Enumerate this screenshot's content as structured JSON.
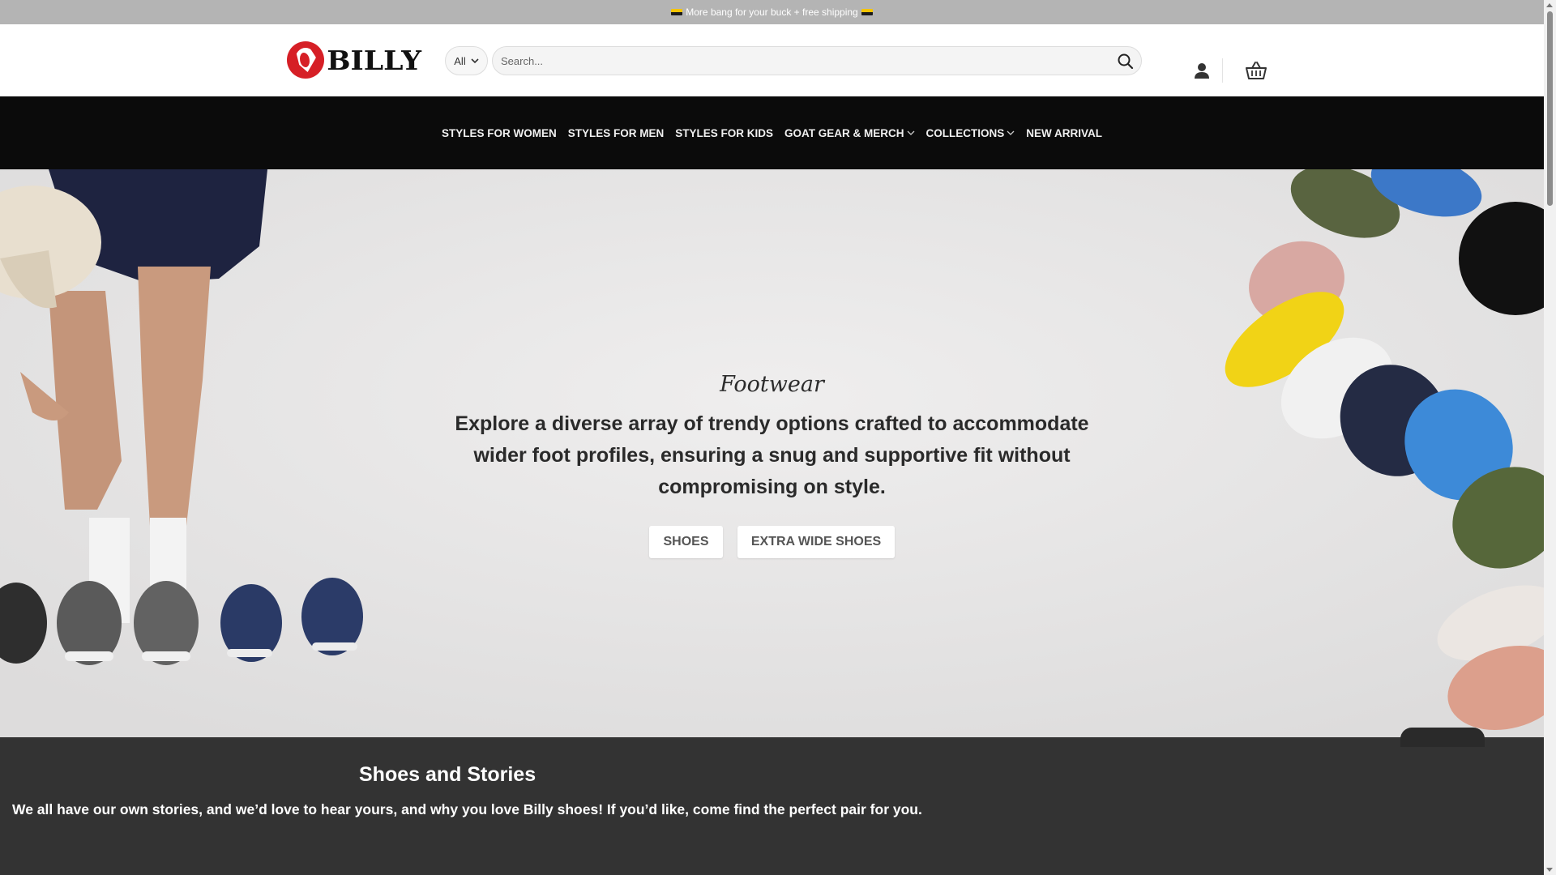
{
  "promo": {
    "text": "More bang for your buck + free shipping"
  },
  "header": {
    "logo_text": "BILLY",
    "search": {
      "category": "All",
      "placeholder": "Search..."
    }
  },
  "nav": {
    "items": [
      {
        "label": "STYLES FOR WOMEN",
        "has_dropdown": false
      },
      {
        "label": "STYLES FOR MEN",
        "has_dropdown": false
      },
      {
        "label": "STYLES FOR KIDS",
        "has_dropdown": false
      },
      {
        "label": "GOAT GEAR & MERCH",
        "has_dropdown": true
      },
      {
        "label": "COLLECTIONS",
        "has_dropdown": true
      },
      {
        "label": "NEW ARRIVAL",
        "has_dropdown": false
      }
    ]
  },
  "hero": {
    "eyebrow": "Footwear",
    "text": "Explore a diverse array of trendy options crafted to accommodate wider foot profiles, ensuring a snug and supportive fit without compromising on style.",
    "buttons": {
      "shoes": "SHOES",
      "wide": "EXTRA WIDE SHOES"
    }
  },
  "stories": {
    "title": "Shoes and Stories",
    "text": "We all have our own stories, and we’d love to hear yours, and why you love Billy shoes! If you’d like, come find the perfect pair for you."
  },
  "colors": {
    "nav_bg": "#0b0b0b",
    "promo_bg": "#b4b4b4",
    "stories_bg": "#333333",
    "brand_red": "#d61f26"
  }
}
